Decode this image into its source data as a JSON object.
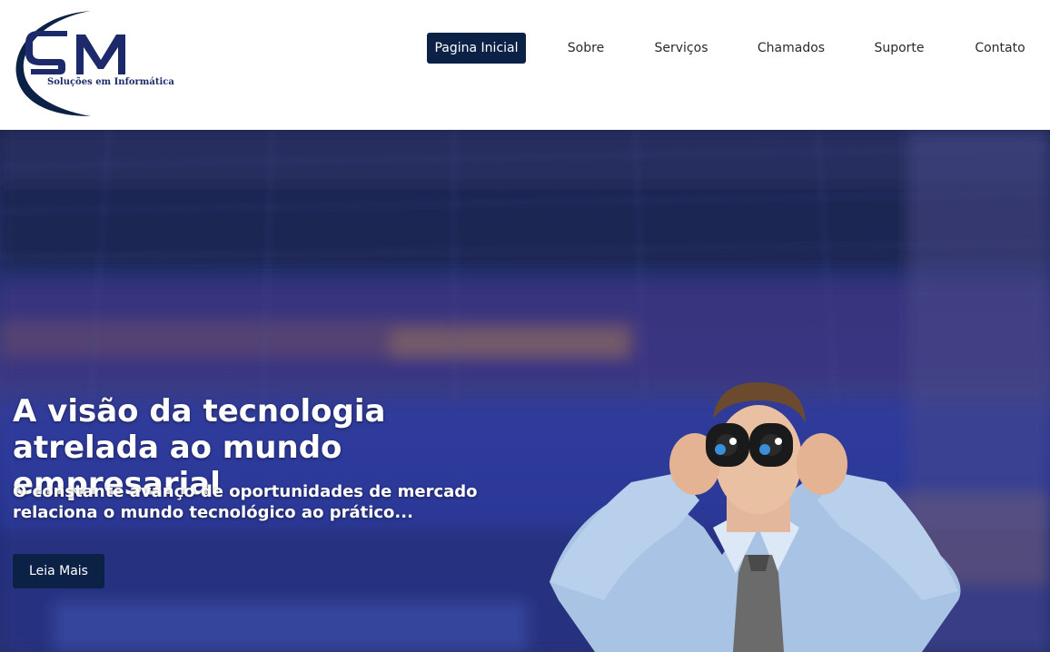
{
  "brand": {
    "logo_letters": "SM",
    "tagline": "Soluções em Informática",
    "primary_color": "#0c2146",
    "logo_color": "#1c2a6b"
  },
  "nav": {
    "items": [
      {
        "label": "Pagina Inicial",
        "active": true
      },
      {
        "label": "Sobre",
        "active": false
      },
      {
        "label": "Serviços",
        "active": false
      },
      {
        "label": "Chamados",
        "active": false
      },
      {
        "label": "Suporte",
        "active": false
      },
      {
        "label": "Contato",
        "active": false
      }
    ]
  },
  "hero": {
    "title": "A visão da tecnologia atrelada ao mundo empresarial",
    "subtitle": "O constante avanço de oportunidades de mercado relaciona o mundo tecnológico ao prático...",
    "button_label": "Leia Mais",
    "image_subject": "businessman-with-binoculars"
  }
}
